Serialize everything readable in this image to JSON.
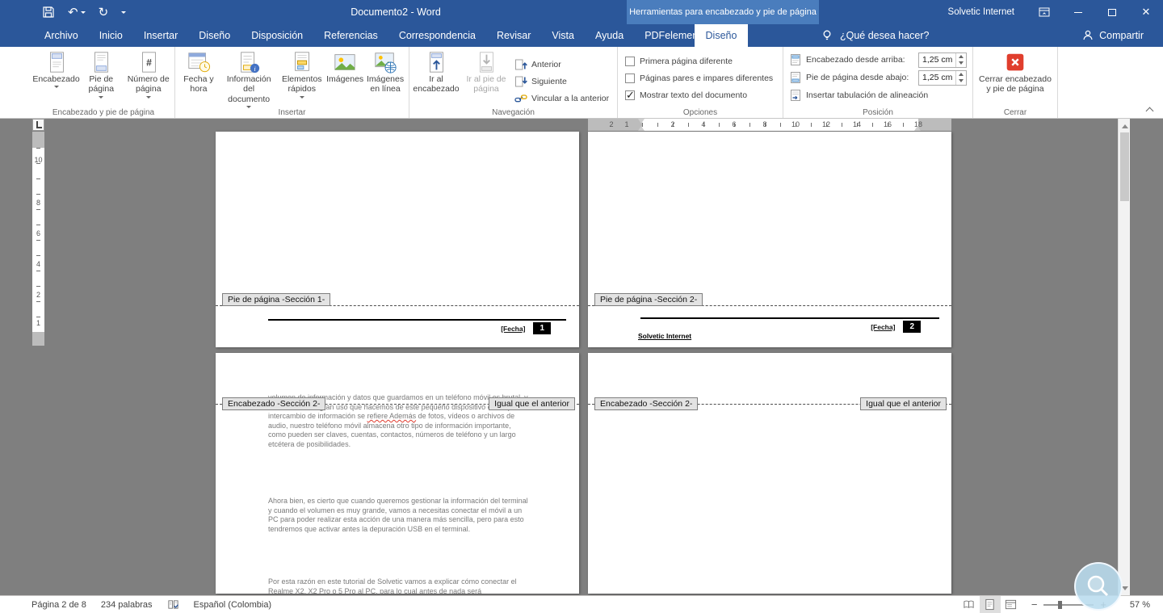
{
  "titlebar": {
    "title": "Documento2 - Word",
    "context_header": "Herramientas para encabezado y pie de página",
    "user": "Solvetic Internet"
  },
  "tabs": {
    "file": "Archivo",
    "items": [
      "Inicio",
      "Insertar",
      "Diseño",
      "Disposición",
      "Referencias",
      "Correspondencia",
      "Revisar",
      "Vista",
      "Ayuda",
      "PDFelement"
    ],
    "contextual": "Diseño",
    "tell_me": "¿Qué desea hacer?",
    "share": "Compartir"
  },
  "ribbon": {
    "header_footer_group": {
      "label": "Encabezado y pie de página",
      "header": "Encabezado",
      "footer": "Pie de página",
      "page_number": "Número de página"
    },
    "insert_group": {
      "label": "Insertar",
      "date_time": "Fecha y hora",
      "doc_info": "Información del documento",
      "quick_parts": "Elementos rápidos",
      "pictures": "Imágenes",
      "online_pictures": "Imágenes en línea"
    },
    "navigation_group": {
      "label": "Navegación",
      "go_header": "Ir al encabezado",
      "go_footer": "Ir al pie de página",
      "previous": "Anterior",
      "next": "Siguiente",
      "link_previous": "Vincular a la anterior"
    },
    "options_group": {
      "label": "Opciones",
      "checkboxes": [
        {
          "label": "Primera página diferente",
          "checked": false
        },
        {
          "label": "Páginas pares e impares diferentes",
          "checked": false
        },
        {
          "label": "Mostrar texto del documento",
          "checked": true
        }
      ]
    },
    "position_group": {
      "label": "Posición",
      "header_from_top": "Encabezado desde arriba:",
      "header_value": "1,25 cm",
      "footer_from_bottom": "Pie de página desde abajo:",
      "footer_value": "1,25 cm",
      "alignment_tab": "Insertar tabulación de alineación"
    },
    "close_group": {
      "label": "Cerrar",
      "close_button": "Cerrar encabezado y pie de página"
    }
  },
  "ruler": {
    "h_numbers": [
      "2",
      "1",
      "2",
      "4",
      "6",
      "8",
      "10",
      "12",
      "14",
      "16",
      "18"
    ],
    "v_numbers": [
      "10",
      "8",
      "6",
      "4",
      "2",
      "1"
    ]
  },
  "document": {
    "page1": {
      "footer_tag": "Pie de página -Sección 1-",
      "date_field": "[Fecha]",
      "page_num": "1"
    },
    "page2": {
      "footer_tag": "Pie de página -Sección 2-",
      "date_field": "[Fecha]",
      "page_num": "2",
      "author": "Solvetic Internet"
    },
    "page3": {
      "header_tag": "Encabezado -Sección 2-",
      "same_as_prev": "Igual que el anterior",
      "p1a": "volumen de información y datos que guardamos en un teléfono móvil es brutal, y esto se debe al gran uso que hacemos de este pequeño dispositivo en lo que al intercambio de información se ",
      "p1b": "refiere Además",
      "p1c": " de fotos, vídeos o archivos de audio, nuestro teléfono móvil almacena otro tipo de información importante, como pueden ser claves, cuentas, contactos, números de teléfono y un largo etcétera de posibilidades.",
      "p2": "Ahora bien, es cierto que cuando queremos gestionar la información del terminal y cuando el volumen es muy grande, vamos a necesitas conectar el móvil a un PC para poder realizar esta acción de una manera más sencilla, pero para esto tendremos que activar antes la depuración USB en el terminal.",
      "p3": "Por esta razón en este tutorial de Solvetic vamos a explicar cómo conectar el Realme X2, X2 Pro o 5 Pro al PC, para lo cual antes de nada será imprescindible"
    },
    "page4": {
      "header_tag": "Encabezado -Sección 2-",
      "same_as_prev": "Igual que el anterior"
    }
  },
  "statusbar": {
    "page_info": "Página 2 de 8",
    "words": "234 palabras",
    "language": "Español (Colombia)",
    "zoom": "57 %"
  },
  "icons": {
    "undo": "↶",
    "redo": "↻",
    "close_window": "✕",
    "minus": "−",
    "plus": "+"
  }
}
